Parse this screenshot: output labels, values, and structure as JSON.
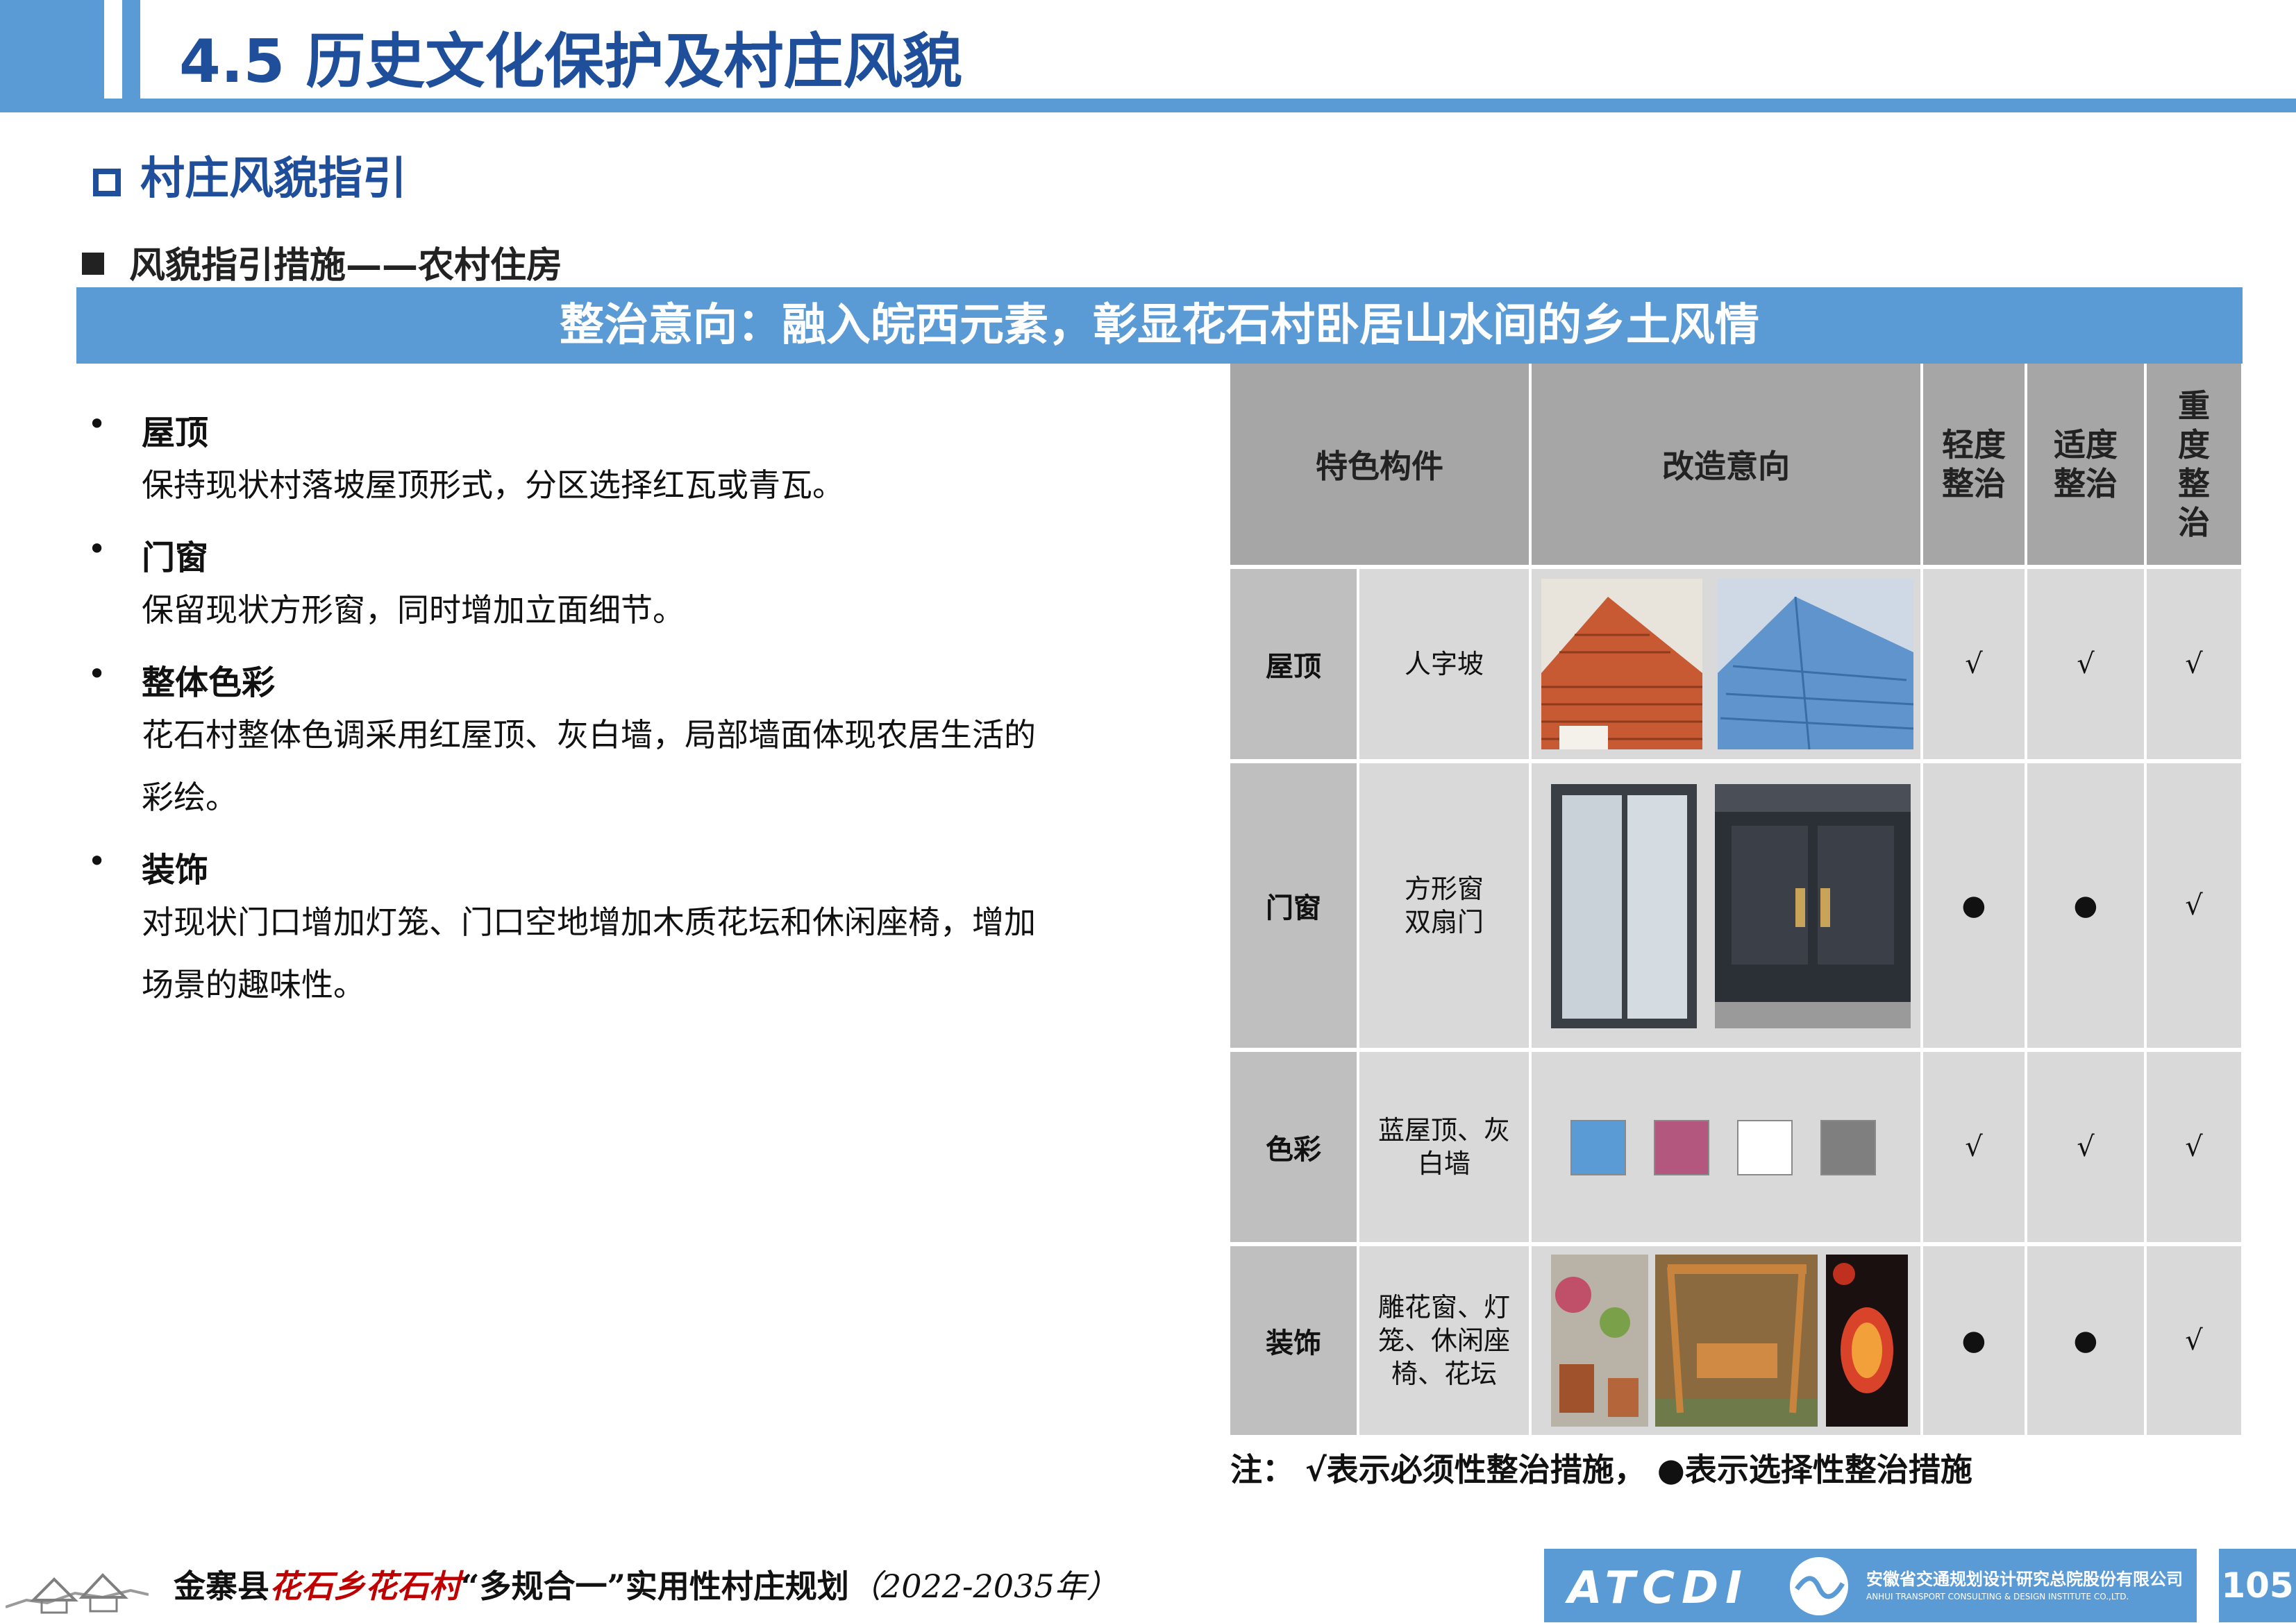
{
  "header": {
    "title": "4.5 历史文化保护及村庄风貌"
  },
  "section": {
    "title": "村庄风貌指引"
  },
  "subsection": {
    "title": "风貌指引措施——农村住房"
  },
  "banner": {
    "text": "整治意向：融入皖西元素，彰显花石村卧居山水间的乡土风情"
  },
  "left_list": [
    {
      "head": "屋顶",
      "body": "保持现状村落坡屋顶形式，分区选择红瓦或青瓦。"
    },
    {
      "head": "门窗",
      "body": "保留现状方形窗，同时增加立面细节。"
    },
    {
      "head": "整体色彩",
      "body": "花石村整体色调采用红屋顶、灰白墙，局部墙面体现农居生活的彩绘。"
    },
    {
      "head": "装饰",
      "body": "对现状门口增加灯笼、门口空地增加木质花坛和休闲座椅，增加场景的趣味性。"
    }
  ],
  "bullet_glyph": "•",
  "table": {
    "headers": {
      "component": "特色构件",
      "intent": "改造意向",
      "light": "轻度整治",
      "moderate": "适度整治",
      "heavy": "重度整治"
    },
    "rows": [
      {
        "name": "屋顶",
        "type": "人字坡",
        "light": "√",
        "moderate": "√",
        "heavy": "√"
      },
      {
        "name": "门窗",
        "type": "方形窗双扇门",
        "light": "●",
        "moderate": "●",
        "heavy": "√"
      },
      {
        "name": "色彩",
        "type": "蓝屋顶、灰白墙",
        "light": "√",
        "moderate": "√",
        "heavy": "√",
        "swatches": [
          "#5b9bd5",
          "#b4577f",
          "#ffffff",
          "#7f7f7f"
        ]
      },
      {
        "name": "装饰",
        "type": "雕花窗、灯笼、休闲座椅、花坛",
        "light": "●",
        "moderate": "●",
        "heavy": "√"
      }
    ]
  },
  "note": {
    "text": "注：  √表示必须性整治措施，  ●表示选择性整治措施"
  },
  "footer": {
    "county": "金寨县",
    "village": "花石乡花石村",
    "project": "“多规合一”实用性村庄规划",
    "years": "（2022-2035年）",
    "logo_text": "ATCDI",
    "company_cn": "安徽省交通规划设计研究总院股份有限公司",
    "company_en": "ANHUI TRANSPORT CONSULTING & DESIGN INSTITUTE CO.,LTD.",
    "page": "105"
  },
  "colors": {
    "accent": "#5b9bd5",
    "title_blue": "#1f4e9a",
    "footer_red": "#c00000"
  }
}
